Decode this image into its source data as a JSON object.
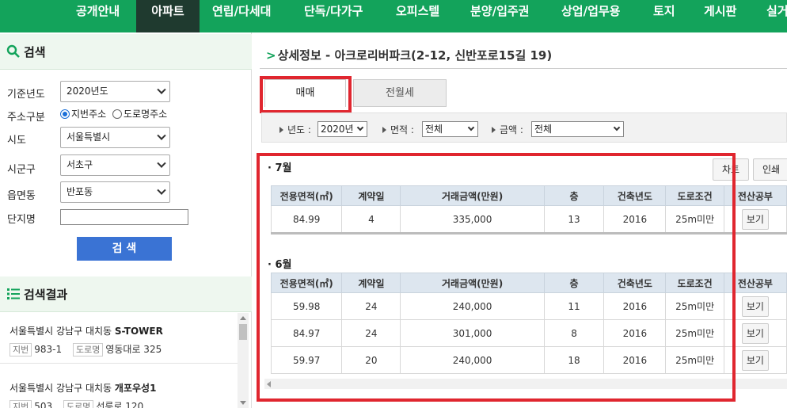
{
  "nav": {
    "items": [
      "공개안내",
      "아파트",
      "연립/다세대",
      "단독/다가구",
      "오피스텔",
      "분양/입주권",
      "상업/업무용",
      "토지",
      "게시판",
      "실거"
    ],
    "active_index": 1
  },
  "search_panel": {
    "title": "검색",
    "fields": {
      "year_label": "기준년도",
      "year_value": "2020년도",
      "addr_type_label": "주소구분",
      "addr_option1": "지번주소",
      "addr_option2": "도로명주소",
      "sido_label": "시도",
      "sido_value": "서울특별시",
      "sigungu_label": "시군구",
      "sigungu_value": "서초구",
      "dong_label": "읍면동",
      "dong_value": "반포동",
      "complex_label": "단지명",
      "complex_value": ""
    },
    "search_button": "검 색"
  },
  "results_panel": {
    "title": "검색결과",
    "items": [
      {
        "address": "서울특별시 강남구 대치동",
        "name": "S-TOWER",
        "tag1": "지번",
        "val1": "983-1",
        "tag2": "도로명",
        "val2": "영동대로 325"
      },
      {
        "address": "서울특별시 강남구 대치동",
        "name": "개포우성1",
        "tag1": "지번",
        "val1": "503",
        "tag2": "도로명",
        "val2": "선릉로 120"
      }
    ]
  },
  "detail": {
    "title_prefix": "상세정보 - ",
    "title_name": "아크로리버파크(2-12, 신반포로15길 19)",
    "tabs": [
      "매매",
      "전월세"
    ],
    "filters": {
      "year_label": "년도 :",
      "year_value": "2020년",
      "area_label": "면적 :",
      "area_value": "전체",
      "amount_label": "금액 :",
      "amount_value": "전체"
    },
    "buttons": {
      "chart": "차트",
      "print": "인쇄"
    },
    "columns": [
      "전용면적(㎡)",
      "계약일",
      "거래금액(만원)",
      "층",
      "건축년도",
      "도로조건",
      "전산공부"
    ],
    "view_label": "보기",
    "months": [
      {
        "label": "· 7월",
        "rows": [
          [
            "84.99",
            "4",
            "335,000",
            "13",
            "2016",
            "25m미만"
          ]
        ]
      },
      {
        "label": "· 6월",
        "rows": [
          [
            "59.98",
            "24",
            "240,000",
            "11",
            "2016",
            "25m미만"
          ],
          [
            "84.97",
            "24",
            "301,000",
            "8",
            "2016",
            "25m미만"
          ],
          [
            "59.97",
            "20",
            "240,000",
            "18",
            "2016",
            "25m미만"
          ]
        ]
      }
    ]
  }
}
